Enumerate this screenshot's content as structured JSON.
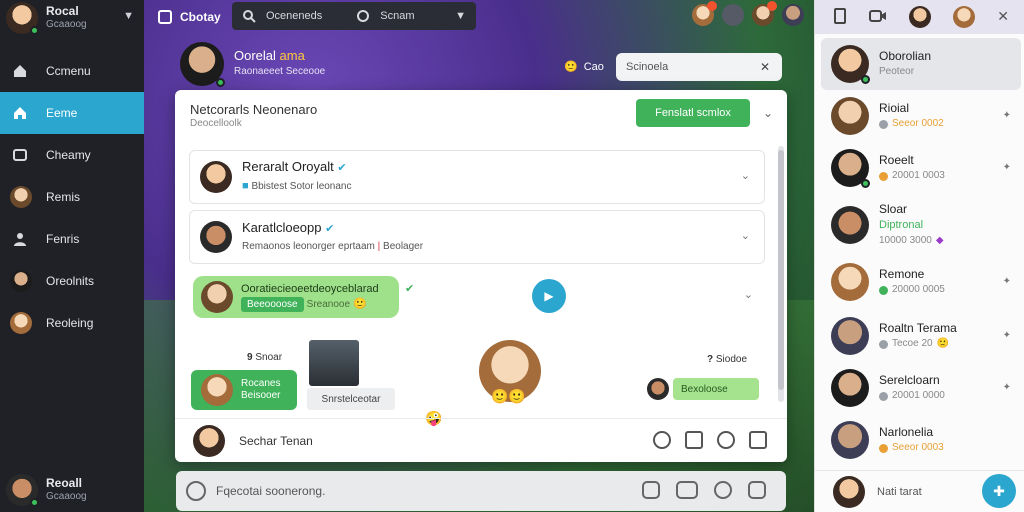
{
  "sidebar": {
    "profile": {
      "name": "Rocal",
      "subtitle": "Gcaaoog"
    },
    "items": [
      {
        "label": "Ccmenu",
        "icon": "home-icon"
      },
      {
        "label": "Eeme",
        "icon": "home-icon",
        "active": true
      },
      {
        "label": "Cheamy",
        "icon": "inbox-icon"
      },
      {
        "label": "Remis",
        "icon": "avatar"
      },
      {
        "label": "Fenris",
        "icon": "person-icon"
      },
      {
        "label": "Oreolnits",
        "icon": "avatar"
      },
      {
        "label": "Reoleing",
        "icon": "avatar"
      }
    ],
    "bottom_user": {
      "name": "Reoall",
      "subtitle": "Gcaaoog"
    }
  },
  "topbar": {
    "title": "Cbotay",
    "search_placeholder": "Oceneneds",
    "option_label": "Scnam",
    "badge_colors": [
      "#f0532e",
      "#f0532e"
    ]
  },
  "chat_header": {
    "name": "Oorelal",
    "name_accent": "ama",
    "subtitle": "Raonaeeet Seceooe",
    "mid_label": "Cao",
    "search_placeholder": "Scinoela"
  },
  "card": {
    "title": "Netcorarls Neonenaro",
    "subtitle": "Deocelloolk",
    "action_button": "Fenslatl scmlox",
    "rows": [
      {
        "name": "Reraralt Oroyalt",
        "detail": "Bbistest Sotor leonanc"
      },
      {
        "name": "Karatlcloeopp",
        "detail": "Remaonos leonorger eprtaam",
        "tag": "Beolager"
      }
    ],
    "highlight": {
      "name": "Ooratiecieoeetdeoyceblarad",
      "tag": "Beeoooose",
      "detail": "Sreanooe"
    },
    "messages": {
      "left_count": "9",
      "left_count_label": "Snoar",
      "left_bubble_1": "Rocanes",
      "left_bubble_2": "Beisooer",
      "photo_caption": "Snrstelceotar",
      "right_count": "?",
      "right_count_label": "Siodoe",
      "right_bubble": "Bexoloose"
    },
    "footer_name": "Sechar Tenan"
  },
  "composer": {
    "placeholder": "Fqecotai soonerong."
  },
  "right_panel": {
    "contacts": [
      {
        "name": "Oborolian",
        "status": "Peoteor",
        "avatar": "a1",
        "selected": true
      },
      {
        "name": "Rioial",
        "status": "Seeor 0002",
        "dot": "#e8a035",
        "avatar": "a2"
      },
      {
        "name": "Roeelt",
        "status": "20001 0003",
        "dot": "#e8a035",
        "avatar": "a3"
      },
      {
        "name": "Sloar",
        "status": "10000 3000",
        "accent": "Diptronal",
        "avatar": "a4"
      },
      {
        "name": "Remone",
        "status": "20000 0005",
        "dot": "#3fb25a",
        "avatar": "a5"
      },
      {
        "name": "Roaltn Terama",
        "status": "Tecoe 20",
        "dot": "#9aa0a8",
        "avatar": "a6"
      },
      {
        "name": "Serelcloarn",
        "status": "20001 0000",
        "dot": "#9aa0a8",
        "avatar": "a3"
      },
      {
        "name": "Narlonelia",
        "status": "Seeor 0003",
        "dot": "#e8a035",
        "avatar": "a6"
      }
    ],
    "bottom_name": "Nati tarat"
  },
  "colors": {
    "accent": "#2ba6cf",
    "green": "#3fb25a",
    "sidebar_bg": "#1f2126"
  }
}
